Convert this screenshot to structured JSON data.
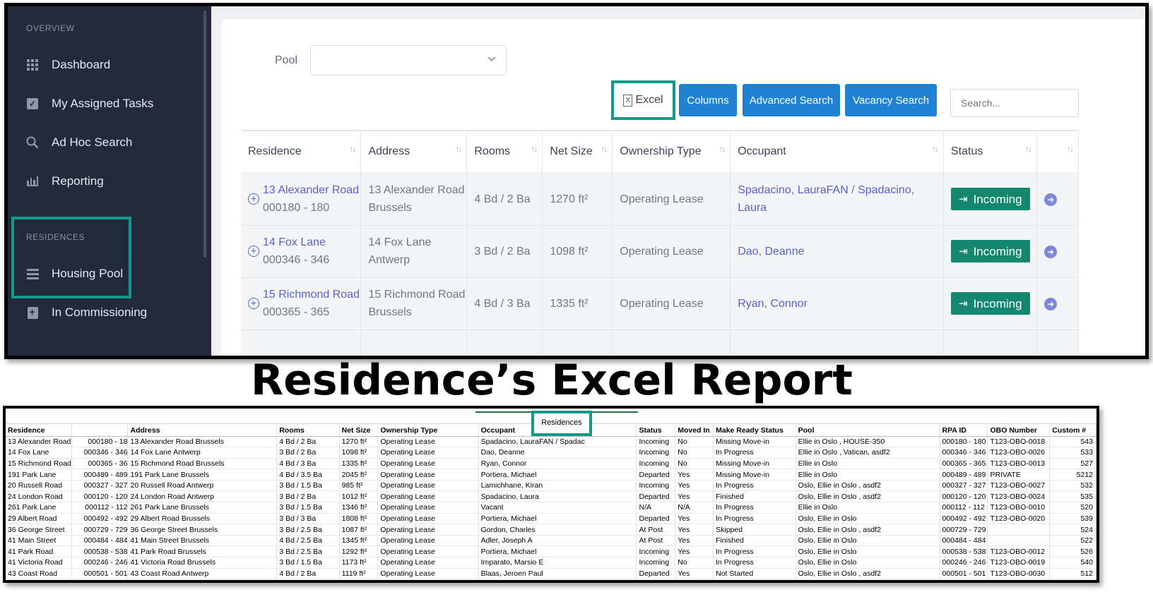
{
  "sidebar": {
    "overview_label": "OVERVIEW",
    "overview_items": [
      {
        "label": "Dashboard",
        "icon": "dashboard-icon"
      },
      {
        "label": "My Assigned Tasks",
        "icon": "checkbox-icon"
      },
      {
        "label": "Ad Hoc Search",
        "icon": "search-icon"
      },
      {
        "label": "Reporting",
        "icon": "bar-chart-icon"
      }
    ],
    "residences_label": "RESIDENCES",
    "residences_items": [
      {
        "label": "Housing Pool",
        "icon": "list-icon"
      },
      {
        "label": "In Commissioning",
        "icon": "commissioning-icon"
      }
    ]
  },
  "filters": {
    "pool_label": "Pool",
    "pool_value": ""
  },
  "toolbar": {
    "excel_label": "Excel",
    "columns_label": "Columns",
    "advanced_search_label": "Advanced Search",
    "vacancy_search_label": "Vacancy Search",
    "search_placeholder": "Search..."
  },
  "table": {
    "columns": [
      "Residence",
      "Address",
      "Rooms",
      "Net Size",
      "Ownership Type",
      "Occupant",
      "Status",
      ""
    ],
    "rows": [
      {
        "residence_name": "13 Alexander Road",
        "residence_id": "000180 - 180",
        "address_line1": "13 Alexander Road",
        "address_line2": "Brussels",
        "rooms": "4 Bd / 2 Ba",
        "net_size": "1270 ft²",
        "ownership": "Operating Lease",
        "occupant_a": "Spadacino, LauraFAN",
        "occupant_sep": "/",
        "occupant_b": "Spadacino, Laura",
        "status": "Incoming"
      },
      {
        "residence_name": "14 Fox Lane",
        "residence_id": "000346 - 346",
        "address_line1": "14 Fox Lane",
        "address_line2": "Antwerp",
        "rooms": "3 Bd / 2 Ba",
        "net_size": "1098 ft²",
        "ownership": "Operating Lease",
        "occupant_a": "Dao, Deanne",
        "occupant_sep": "",
        "occupant_b": "",
        "status": "Incoming"
      },
      {
        "residence_name": "15 Richmond Road",
        "residence_id": "000365 - 365",
        "address_line1": "15 Richmond Road",
        "address_line2": "Brussels",
        "rooms": "4 Bd / 3 Ba",
        "net_size": "1335 ft²",
        "ownership": "Operating Lease",
        "occupant_a": "Ryan, Connor",
        "occupant_sep": "",
        "occupant_b": "",
        "status": "Incoming"
      }
    ],
    "status_color": "#15876f",
    "link_color": "#5662d1"
  },
  "report_title": "Residence’s Excel Report",
  "sheet": {
    "tab_label": "Residences",
    "columns": [
      "Residence",
      "",
      "Address",
      "Rooms",
      "Net Size",
      "Ownership Type",
      "Occupant",
      "Status",
      "Moved In",
      "Make Ready Status",
      "Pool",
      "RPA ID",
      "OBO Number",
      "Custom #"
    ],
    "rows": [
      [
        "13 Alexander Road",
        "000180 - 18",
        "13 Alexander Road Brussels",
        "4 Bd / 2 Ba",
        "1270 ft²",
        "Operating Lease",
        "Spadacino, LauraFAN          /           Spadac",
        "Incoming",
        "No",
        "Missing Move-in",
        "Ellie in Oslo , HOUSE-350",
        "000180 - 180",
        "T123-OBO-0018",
        "543"
      ],
      [
        "14 Fox Lane",
        "000346 - 346",
        "14 Fox Lane Antwerp",
        "3 Bd / 2 Ba",
        "1098 ft²",
        "Operating Lease",
        "Dao, Deanne",
        "Incoming",
        "No",
        "In Progress",
        "Ellie in Oslo , Vatican, asdf2",
        "000346 - 346",
        "T123-OBO-0026",
        "533"
      ],
      [
        "15 Richmond Road",
        "000365 - 36",
        "15 Richmond Road Brussels",
        "4 Bd / 3 Ba",
        "1335 ft²",
        "Operating Lease",
        "Ryan, Connor",
        "Incoming",
        "No",
        "Missing Move-in",
        "Ellie in Oslo",
        "000365 - 365",
        "T123-OBO-0013",
        "527"
      ],
      [
        "191 Park Lane",
        "000489 - 489",
        "191 Park Lane Brussels",
        "4 Bd / 3.5 Ba",
        "2045 ft²",
        "Operating Lease",
        "Portiera, Michael",
        "Departed",
        "Yes",
        "Missing Move-in",
        "Ellie in Oslo",
        "000489 - 489",
        "PRIVATE",
        "5212"
      ],
      [
        "20 Russell Road",
        "000327 - 327",
        "20 Russell Road Antwerp",
        "3 Bd / 1.5 Ba",
        "985 ft²",
        "Operating Lease",
        "Lamichhane, Kiran",
        "Incoming",
        "Yes",
        "In Progress",
        "Oslo, Ellie in Oslo , asdf2",
        "000327 - 327",
        "T123-OBO-0027",
        "532"
      ],
      [
        "24 London Road",
        "000120 - 120",
        "24 London Road Antwerp",
        "3 Bd / 2 Ba",
        "1012 ft²",
        "Operating Lease",
        "Spadacino, Laura",
        "Departed",
        "Yes",
        "Finished",
        "Oslo, Ellie in Oslo , asdf2",
        "000120 - 120",
        "T123-OBO-0024",
        "535"
      ],
      [
        "261 Park Lane",
        "000112 - 112",
        "261 Park Lane Brussels",
        "3 Bd / 1.5 Ba",
        "1346 ft²",
        "Operating Lease",
        "Vacant",
        "N/A",
        "N/A",
        "In Progress",
        "Ellie in Oslo",
        "000112 - 112",
        "T123-OBO-0010",
        "520"
      ],
      [
        "29 Albert Road",
        "000492 - 492",
        "29 Albert Road Brussels",
        "3 Bd / 3 Ba",
        "1808 ft²",
        "Operating Lease",
        "Portiera, Michael",
        "Departed",
        "Yes",
        "In Progress",
        "Oslo, Ellie in Oslo",
        "000492 - 492",
        "T123-OBO-0020",
        "539"
      ],
      [
        "36 George Street",
        "000729 - 729",
        "36 George Street Brussels",
        "3 Bd / 2.5 Ba",
        "1087 ft²",
        "Operating Lease",
        "Gordon, Charles",
        "At Post",
        "Yes",
        "Skipped",
        "Oslo, Ellie in Oslo , asdf2",
        "000729 - 729",
        "",
        "524"
      ],
      [
        "41 Main Street",
        "000484 - 484",
        "41 Main Street Brussels",
        "4 Bd / 2.5 Ba",
        "1345 ft²",
        "Operating Lease",
        "Adler, Joseph A",
        "At Post",
        "Yes",
        "Finished",
        "Oslo, Ellie in Oslo",
        "000484 - 484",
        "",
        "522"
      ],
      [
        "41 Park Road",
        "000538 - 538",
        "41 Park Road Brussels",
        "3 Bd / 2.5 Ba",
        "1292 ft²",
        "Operating Lease",
        "Portiera, Michael",
        "Incoming",
        "Yes",
        "In Progress",
        "Oslo, Ellie in Oslo",
        "000538 - 538",
        "T123-OBO-0012",
        "526"
      ],
      [
        "41 Victoria Road",
        "000246 - 246",
        "41 Victoria Road Brussels",
        "3 Bd / 1.5 Ba",
        "1173 ft²",
        "Operating Lease",
        "Imparato, Marsio E",
        "Incoming",
        "No",
        "In Progress",
        "Oslo, Ellie in Oslo",
        "000246 - 246",
        "T123-OBO-0019",
        "540"
      ],
      [
        "43 Coast Road",
        "000501 - 501",
        "43 Coast Road Antwerp",
        "4 Bd / 2 Ba",
        "1119 ft²",
        "Operating Lease",
        "Blaas, Jeroen Paul",
        "Departed",
        "Yes",
        "Not Started",
        "Oslo, Ellie in Oslo , asdf2",
        "000501 - 501",
        "T123-OBO-0030",
        "512"
      ]
    ],
    "accent": "#217346"
  },
  "highlight_color": "#119a8a",
  "button_color": "#1f82d3",
  "sidebar_color": "#232a3b"
}
